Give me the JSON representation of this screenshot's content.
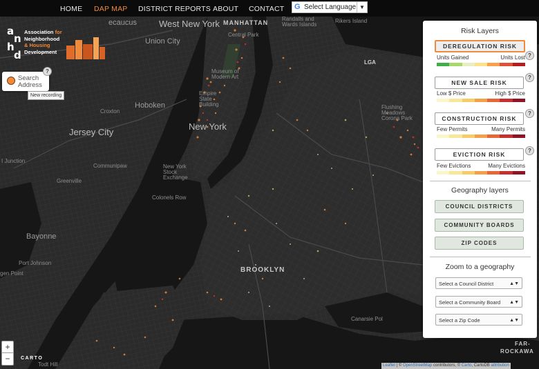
{
  "nav": {
    "items": [
      {
        "label": "HOME",
        "active": false
      },
      {
        "label": "DAP MAP",
        "active": true
      },
      {
        "label": "DISTRICT REPORTS",
        "active": false
      },
      {
        "label": "ABOUT",
        "active": false
      },
      {
        "label": "CONTACT",
        "active": false
      }
    ],
    "language_label": "Select Language",
    "language_icon": "google-g-icon"
  },
  "logo": {
    "letters": [
      "a",
      "n",
      "h",
      "d"
    ],
    "org_line1": "Association",
    "org_line1b": "for",
    "org_line2": "Neighborhood",
    "org_line3": "& Housing",
    "org_line4": "Development"
  },
  "search": {
    "placeholder": "Search Address",
    "help": "?",
    "tooltip": "New recording"
  },
  "map": {
    "labels": {
      "ecaucus": "ecaucus",
      "west_new_york": "West New York",
      "union_city": "Union City",
      "hoboken": "Hoboken",
      "croxton": "Croxton",
      "jersey_city": "Jersey City",
      "junction": "I Junction",
      "communipaw": "Communipaw",
      "greenville": "Greenville",
      "colonels_row": "Colonels Row",
      "bayonne": "Bayonne",
      "port_jsm": "Port Johnson",
      "port_johnson": "Port Johnson",
      "port_richmond": "Port Johnson",
      "gen_point": "gen Point",
      "new_york": "New York",
      "nyse": "New York Stock Exchange",
      "manhattan": "MANHATTAN",
      "central_park": "Central Park",
      "moma": "Museum of Modern Art",
      "empire_state": "Empire State Building",
      "randalls": "Randalls and Wards Islands",
      "rikers": "Rikers Island",
      "lga": "LGA",
      "flushing": "Flushing Meadows Corona Park",
      "brooklyn": "BROOKLYN",
      "canarsie": "Canarsie Pol",
      "far_rockaway_1": "FAR-",
      "far_rockaway_2": "ROCKAWA",
      "todt_hill": "Todt Hill"
    },
    "zoom_in": "+",
    "zoom_out": "−",
    "carto": "CARTO",
    "attribution": {
      "leaflet": "Leaflet",
      "sep": " | © ",
      "osm": "OpenStreetMap",
      "contrib": " contributors, © ",
      "carto": "Carto",
      "cartodb": ", CartoDB ",
      "attr": "attribution"
    }
  },
  "panel": {
    "risk_title": "Risk Layers",
    "risk_layers": [
      {
        "label": "DEREGULATION RISK",
        "active": true,
        "low": "Units Gained",
        "high": "Units Lost",
        "ramp": [
          "#3fae49",
          "#a6d96a",
          "#e8eec0",
          "#fee08b",
          "#f9a04a",
          "#e0513a",
          "#b71c1c"
        ]
      },
      {
        "label": "NEW SALE RISK",
        "active": false,
        "low": "Low $ Price",
        "high": "High $ Price",
        "ramp": [
          "#fbf6c8",
          "#f8e79a",
          "#f6cc6a",
          "#f2a04a",
          "#e66637",
          "#c62f2f",
          "#8f1426"
        ]
      },
      {
        "label": "CONSTRUCTION RISK",
        "active": false,
        "low": "Few Permits",
        "high": "Many Permits",
        "ramp": [
          "#fbf6c8",
          "#f8e79a",
          "#f6cc6a",
          "#f2a04a",
          "#e66637",
          "#c62f2f",
          "#8f1426"
        ]
      },
      {
        "label": "EVICTION RISK",
        "active": false,
        "low": "Few Evictions",
        "high": "Many Evictions",
        "ramp": [
          "#fbf6c8",
          "#f8e79a",
          "#f6cc6a",
          "#f2a04a",
          "#e66637",
          "#c62f2f",
          "#8f1426"
        ]
      }
    ],
    "geo_title": "Geography layers",
    "geo_layers": [
      "COUNCIL DISTRICTS",
      "COMMUNITY BOARDS",
      "ZIP CODES"
    ],
    "zoom_title": "Zoom to a geography",
    "zoom_selects": [
      "Select a Council District",
      "Select a Community Board",
      "Select a Zip Code"
    ],
    "help": "?"
  },
  "colors": {
    "accent": "#f08a3c",
    "nav_bg": "#0b0b0b",
    "map_bg": "#262626",
    "water": "#151515",
    "land": "#2c2c2c"
  }
}
